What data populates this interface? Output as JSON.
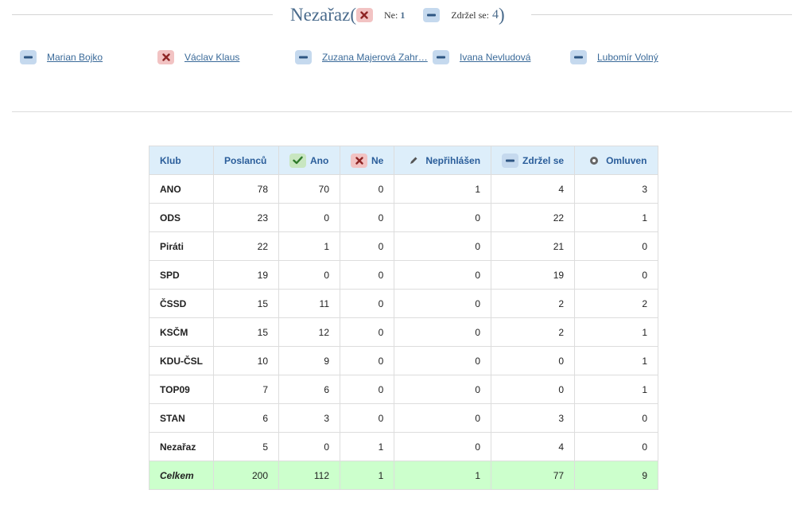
{
  "group": {
    "title": "Nezařaz",
    "paren_open": "(",
    "paren_close": ")",
    "stats": [
      {
        "icon": "x-icon",
        "label": "Ne:",
        "count": "1"
      },
      {
        "icon": "dash-icon",
        "label": "Zdržel se:",
        "count": "4"
      }
    ]
  },
  "deputies": [
    {
      "name": "Marian Bojko",
      "vote_icon": "dash-icon"
    },
    {
      "name": "Václav Klaus",
      "vote_icon": "x-icon"
    },
    {
      "name": "Zuzana Majerová Zahr…",
      "vote_icon": "dash-icon"
    },
    {
      "name": "Ivana Nevludová",
      "vote_icon": "dash-icon"
    },
    {
      "name": "Lubomír Volný",
      "vote_icon": "dash-icon"
    }
  ],
  "table": {
    "headers": {
      "club": "Klub",
      "members": "Poslanců",
      "yes": "Ano",
      "no": "Ne",
      "not_logged": "Nepřihlášen",
      "abstain": "Zdržel se",
      "excused": "Omluven"
    },
    "header_icons": {
      "yes": "check-icon",
      "no": "x-icon",
      "not_logged": "pencil-icon",
      "abstain": "dash-icon",
      "excused": "circle-dot-icon"
    },
    "rows": [
      {
        "club": "ANO",
        "members": "78",
        "yes": "70",
        "no": "0",
        "not_logged": "1",
        "abstain": "4",
        "excused": "3"
      },
      {
        "club": "ODS",
        "members": "23",
        "yes": "0",
        "no": "0",
        "not_logged": "0",
        "abstain": "22",
        "excused": "1"
      },
      {
        "club": "Piráti",
        "members": "22",
        "yes": "1",
        "no": "0",
        "not_logged": "0",
        "abstain": "21",
        "excused": "0"
      },
      {
        "club": "SPD",
        "members": "19",
        "yes": "0",
        "no": "0",
        "not_logged": "0",
        "abstain": "19",
        "excused": "0"
      },
      {
        "club": "ČSSD",
        "members": "15",
        "yes": "11",
        "no": "0",
        "not_logged": "0",
        "abstain": "2",
        "excused": "2"
      },
      {
        "club": "KSČM",
        "members": "15",
        "yes": "12",
        "no": "0",
        "not_logged": "0",
        "abstain": "2",
        "excused": "1"
      },
      {
        "club": "KDU-ČSL",
        "members": "10",
        "yes": "9",
        "no": "0",
        "not_logged": "0",
        "abstain": "0",
        "excused": "1"
      },
      {
        "club": "TOP09",
        "members": "7",
        "yes": "6",
        "no": "0",
        "not_logged": "0",
        "abstain": "0",
        "excused": "1"
      },
      {
        "club": "STAN",
        "members": "6",
        "yes": "3",
        "no": "0",
        "not_logged": "0",
        "abstain": "3",
        "excused": "0"
      },
      {
        "club": "Nezařaz",
        "members": "5",
        "yes": "0",
        "no": "1",
        "not_logged": "0",
        "abstain": "4",
        "excused": "0"
      }
    ],
    "total": {
      "club": "Celkem",
      "members": "200",
      "yes": "112",
      "no": "1",
      "not_logged": "1",
      "abstain": "77",
      "excused": "9"
    }
  },
  "colors": {
    "header_bg": "#ddeefa",
    "header_text": "#2a5d9a",
    "total_bg": "#ccffcc",
    "link": "#3a6a99",
    "no_badge": "#f2c3c3",
    "abstain_badge": "#c5d9ee",
    "yes_badge": "#c8e6c0"
  }
}
